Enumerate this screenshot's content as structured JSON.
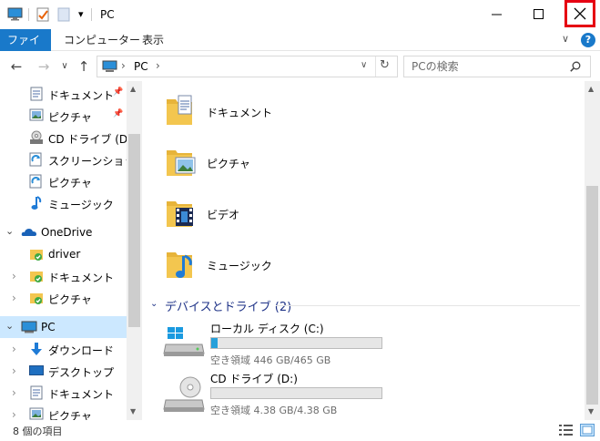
{
  "window": {
    "title": "PC",
    "qat_dropdown": "▾",
    "minimize": "—",
    "maximize": "☐",
    "close": "✕"
  },
  "ribbon": {
    "tabs": [
      "ファイル",
      "コンピューター",
      "表示"
    ],
    "help": "?",
    "collapse": "∨"
  },
  "nav": {
    "back": "←",
    "forward": "→",
    "recent": "∨",
    "up": "↑",
    "address": "PC",
    "address_sep": "›",
    "address_dropdown": "∨",
    "refresh": "↻",
    "search_placeholder": "PCの検索"
  },
  "sidebar": {
    "items": [
      {
        "label": "ドキュメント",
        "icon": "documents-icon",
        "pinned": true
      },
      {
        "label": "ピクチャ",
        "icon": "pictures-icon",
        "pinned": true
      },
      {
        "label": "CD ドライブ (D:)",
        "icon": "cd-drive-icon"
      },
      {
        "label": "スクリーンショット",
        "icon": "screenshot-folder-icon"
      },
      {
        "label": "ピクチャ",
        "icon": "pictures-icon"
      },
      {
        "label": "ミュージック",
        "icon": "music-icon"
      },
      {
        "label": "OneDrive",
        "icon": "onedrive-icon"
      },
      {
        "label": "driver",
        "icon": "folder-sync-icon"
      },
      {
        "label": "ドキュメント",
        "icon": "documents-sync-icon"
      },
      {
        "label": "ピクチャ",
        "icon": "pictures-sync-icon"
      },
      {
        "label": "PC",
        "icon": "pc-icon"
      },
      {
        "label": "ダウンロード",
        "icon": "downloads-icon"
      },
      {
        "label": "デスクトップ",
        "icon": "desktop-icon"
      },
      {
        "label": "ドキュメント",
        "icon": "documents-icon"
      },
      {
        "label": "ピクチャ",
        "icon": "pictures-icon"
      }
    ],
    "pin_glyph": "📌"
  },
  "content": {
    "folders": [
      {
        "label": "ドキュメント",
        "icon": "documents-folder-icon"
      },
      {
        "label": "ピクチャ",
        "icon": "pictures-folder-icon"
      },
      {
        "label": "ビデオ",
        "icon": "videos-folder-icon"
      },
      {
        "label": "ミュージック",
        "icon": "music-folder-icon"
      }
    ],
    "group_header": "デバイスとドライブ (2)",
    "drives": [
      {
        "label": "ローカル ディスク (C:)",
        "free": "空き領域 446 GB/465 GB",
        "used_fraction": 0.04,
        "icon": "local-disk-icon"
      },
      {
        "label": "CD ドライブ (D:)",
        "free": "空き領域 4.38 GB/4.38 GB",
        "used_fraction": 0.0,
        "icon": "cd-drive-icon"
      }
    ]
  },
  "status": {
    "item_count": "8 個の項目"
  },
  "colors": {
    "accent": "#1979ca",
    "selection": "#cce8ff",
    "folder": "#f3c64f",
    "progress": "#26a0da",
    "close_highlight": "#e60012"
  }
}
